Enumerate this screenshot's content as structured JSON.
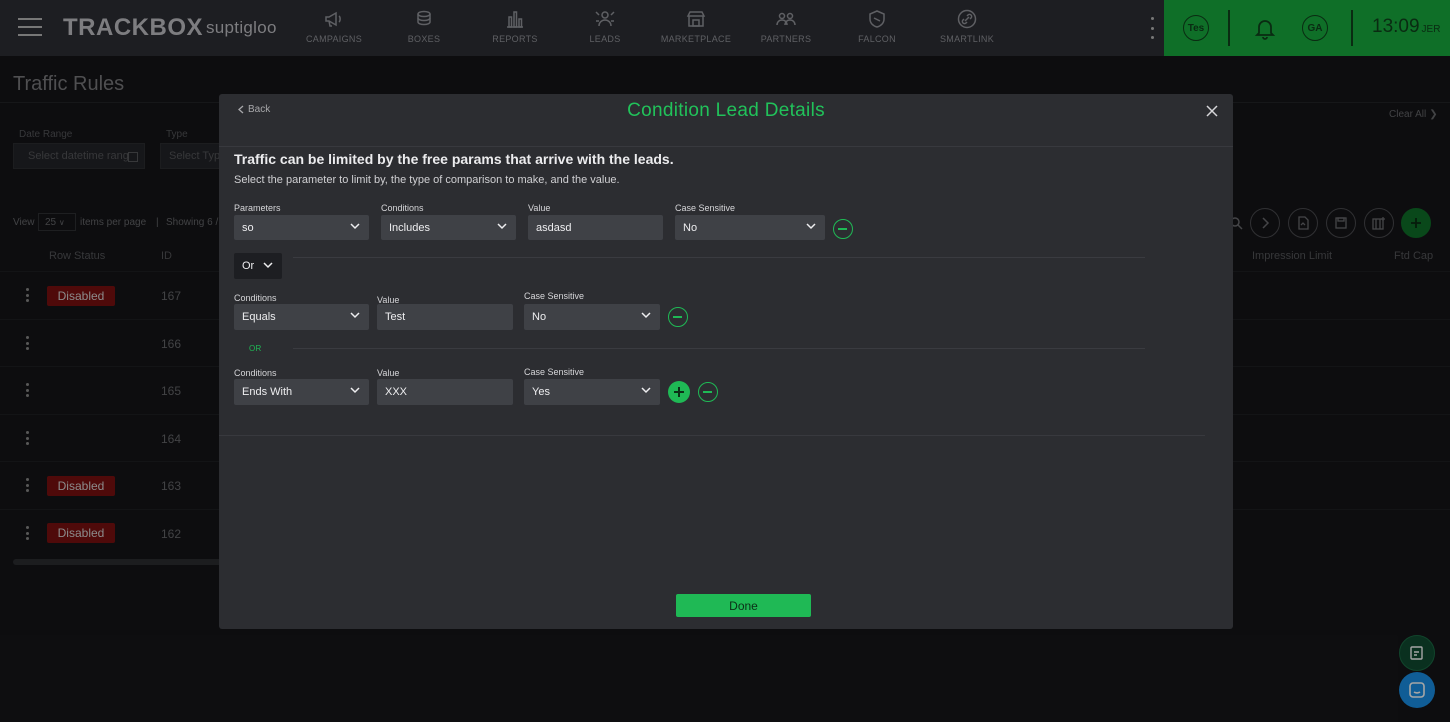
{
  "app": {
    "logo": "TRACKBOX",
    "brand": "suptigloo",
    "nav": [
      {
        "label": "CAMPAIGNS",
        "icon": "megaphone-icon"
      },
      {
        "label": "BOXES",
        "icon": "boxes-icon"
      },
      {
        "label": "REPORTS",
        "icon": "bar-chart-icon"
      },
      {
        "label": "LEADS",
        "icon": "leads-icon"
      },
      {
        "label": "MARKETPLACE",
        "icon": "marketplace-icon"
      },
      {
        "label": "PARTNERS",
        "icon": "partners-icon"
      },
      {
        "label": "FALCON",
        "icon": "shield-icon"
      },
      {
        "label": "SMARTLINK",
        "icon": "link-icon"
      }
    ],
    "account_badge": "Tes",
    "user_initials": "GA",
    "time": "13:09",
    "timezone": "JER",
    "colors": {
      "accent": "#1fb955",
      "header_green": "#0f6f28",
      "danger": "#7a1010"
    }
  },
  "page": {
    "title": "Traffic Rules",
    "filters": [
      {
        "label": "Date Range",
        "placeholder": "Select datetime rang"
      },
      {
        "label": "Type",
        "placeholder": "Select Type"
      }
    ],
    "clear_all": "Clear All",
    "view_label": "View",
    "per_page": "25",
    "items_per_page": "items per page",
    "showing": "Showing 6 /",
    "columns": {
      "row_status": "Row Status",
      "id": "ID",
      "impression_limit": "Impression Limit",
      "ftd_cap": "Ftd Cap"
    },
    "rows": [
      {
        "id": "167",
        "status": "Disabled"
      },
      {
        "id": "166",
        "status": ""
      },
      {
        "id": "165",
        "status": ""
      },
      {
        "id": "164",
        "status": ""
      },
      {
        "id": "163",
        "status": "Disabled"
      },
      {
        "id": "162",
        "status": "Disabled"
      }
    ]
  },
  "modal": {
    "back": "Back",
    "title": "Condition Lead Details",
    "heading": "Traffic can be limited by the free params that arrive with the leads.",
    "subheading": "Select the parameter to limit by, the type of comparison to make, and the value.",
    "labels": {
      "parameters": "Parameters",
      "conditions": "Conditions",
      "value": "Value",
      "case_sensitive": "Case Sensitive"
    },
    "first_row": {
      "parameter": "so",
      "condition": "Includes",
      "value": "asdasd",
      "case_sensitive": "No"
    },
    "group_operator": "Or",
    "or_label": "OR",
    "sub_rows": [
      {
        "condition": "Equals",
        "value": "Test",
        "case_sensitive": "No"
      },
      {
        "condition": "Ends With",
        "value": "XXX",
        "case_sensitive": "Yes"
      }
    ],
    "done": "Done"
  }
}
